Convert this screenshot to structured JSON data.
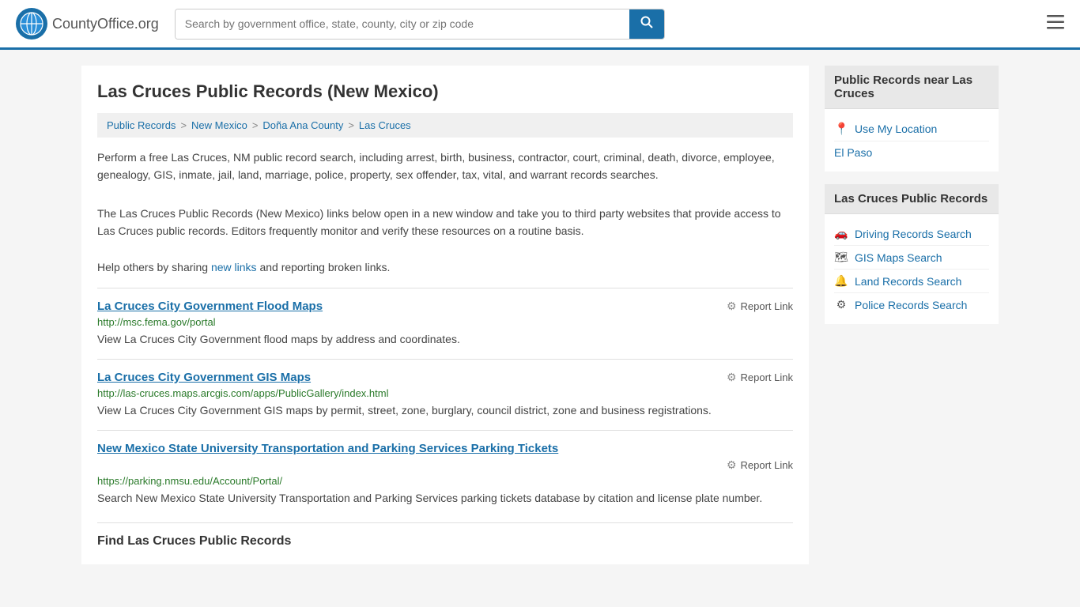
{
  "header": {
    "logo_text": "CountyOffice",
    "logo_suffix": ".org",
    "search_placeholder": "Search by government office, state, county, city or zip code",
    "search_value": ""
  },
  "page": {
    "title": "Las Cruces Public Records (New Mexico)",
    "breadcrumb": [
      {
        "label": "Public Records",
        "href": "#"
      },
      {
        "label": "New Mexico",
        "href": "#"
      },
      {
        "label": "Doña Ana County",
        "href": "#"
      },
      {
        "label": "Las Cruces",
        "href": "#"
      }
    ],
    "description1": "Perform a free Las Cruces, NM public record search, including arrest, birth, business, contractor, court, criminal, death, divorce, employee, genealogy, GIS, inmate, jail, land, marriage, police, property, sex offender, tax, vital, and warrant records searches.",
    "description2": "The Las Cruces Public Records (New Mexico) links below open in a new window and take you to third party websites that provide access to Las Cruces public records. Editors frequently monitor and verify these resources on a routine basis.",
    "help_text_pre": "Help others by sharing ",
    "help_link_label": "new links",
    "help_text_post": " and reporting broken links.",
    "results": [
      {
        "title": "La Cruces City Government Flood Maps",
        "url": "http://msc.fema.gov/portal",
        "description": "View La Cruces City Government flood maps by address and coordinates.",
        "report_label": "Report Link"
      },
      {
        "title": "La Cruces City Government GIS Maps",
        "url": "http://las-cruces.maps.arcgis.com/apps/PublicGallery/index.html",
        "description": "View La Cruces City Government GIS maps by permit, street, zone, burglary, council district, zone and business registrations.",
        "report_label": "Report Link"
      },
      {
        "title": "New Mexico State University Transportation and Parking Services Parking Tickets",
        "url": "https://parking.nmsu.edu/Account/Portal/",
        "description": "Search New Mexico State University Transportation and Parking Services parking tickets database by citation and license plate number.",
        "report_label": "Report Link"
      }
    ],
    "find_section_title": "Find Las Cruces Public Records"
  },
  "sidebar": {
    "nearby_header": "Public Records near Las Cruces",
    "use_location_label": "Use My Location",
    "nearby_links": [
      {
        "label": "El Paso",
        "href": "#"
      }
    ],
    "las_cruces_header": "Las Cruces Public Records",
    "las_cruces_links": [
      {
        "label": "Driving Records Search",
        "icon": "car",
        "href": "#"
      },
      {
        "label": "GIS Maps Search",
        "icon": "map",
        "href": "#"
      },
      {
        "label": "Land Records Search",
        "icon": "land",
        "href": "#"
      },
      {
        "label": "Police Records Search",
        "icon": "police",
        "href": "#"
      }
    ]
  }
}
